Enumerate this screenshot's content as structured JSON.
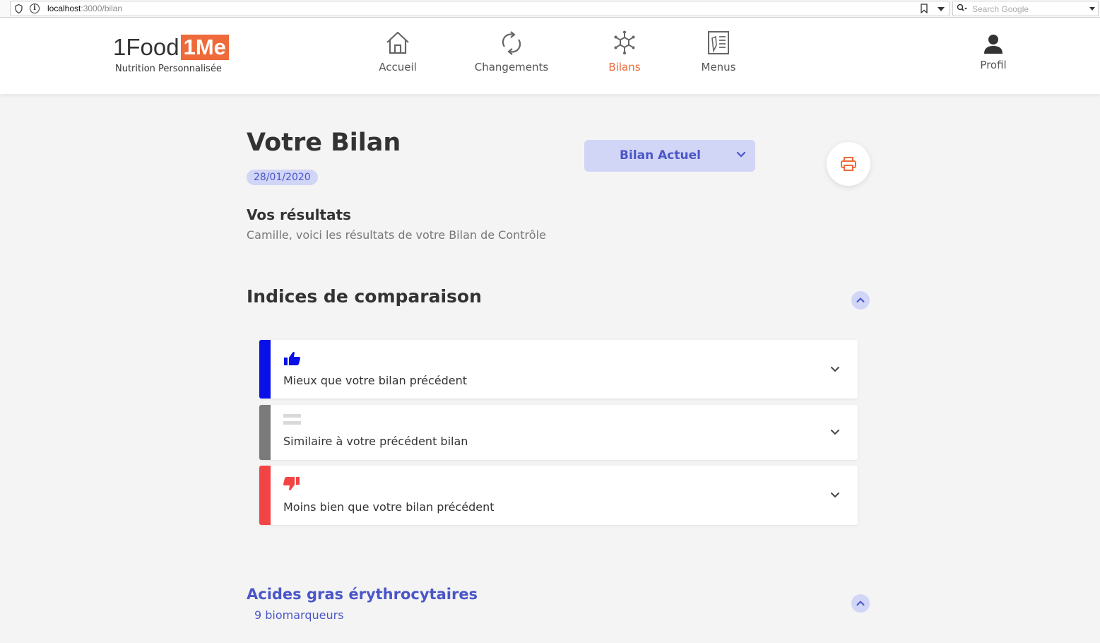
{
  "browser": {
    "url_host": "localhost",
    "url_path": ":3000/bilan",
    "search_placeholder": "Search Google"
  },
  "header": {
    "logo_part1": "1Food",
    "logo_part2": "1Me",
    "logo_tagline": "Nutrition Personnalisée",
    "nav": [
      {
        "label": "Accueil",
        "icon": "home-icon",
        "active": false
      },
      {
        "label": "Changements",
        "icon": "refresh-icon",
        "active": false
      },
      {
        "label": "Bilans",
        "icon": "molecule-icon",
        "active": true
      },
      {
        "label": "Menus",
        "icon": "menu-list-icon",
        "active": false
      }
    ],
    "profile_label": "Profil"
  },
  "main": {
    "title": "Votre Bilan",
    "date": "28/01/2020",
    "bilan_select_value": "Bilan Actuel",
    "results_title": "Vos résultats",
    "results_subtitle": "Camille, voici les résultats de votre Bilan de Contrôle",
    "comparison": {
      "title": "Indices de comparaison",
      "items": [
        {
          "label": "Mieux que votre bilan précédent",
          "icon": "thumbs-up-icon",
          "color": "#0a10e8"
        },
        {
          "label": "Similaire à votre précédent bilan",
          "icon": "equals-icon",
          "color": "#7a7a7a"
        },
        {
          "label": "Moins bien que votre bilan précédent",
          "icon": "thumbs-down-icon",
          "color": "#f24444"
        }
      ]
    },
    "section2": {
      "title": "Acides gras érythrocytaires",
      "subtitle": "9 biomarqueurs"
    }
  },
  "colors": {
    "accent": "#ee6a3a",
    "primary": "#4a56c8",
    "primary_light": "#d1d5f6"
  }
}
